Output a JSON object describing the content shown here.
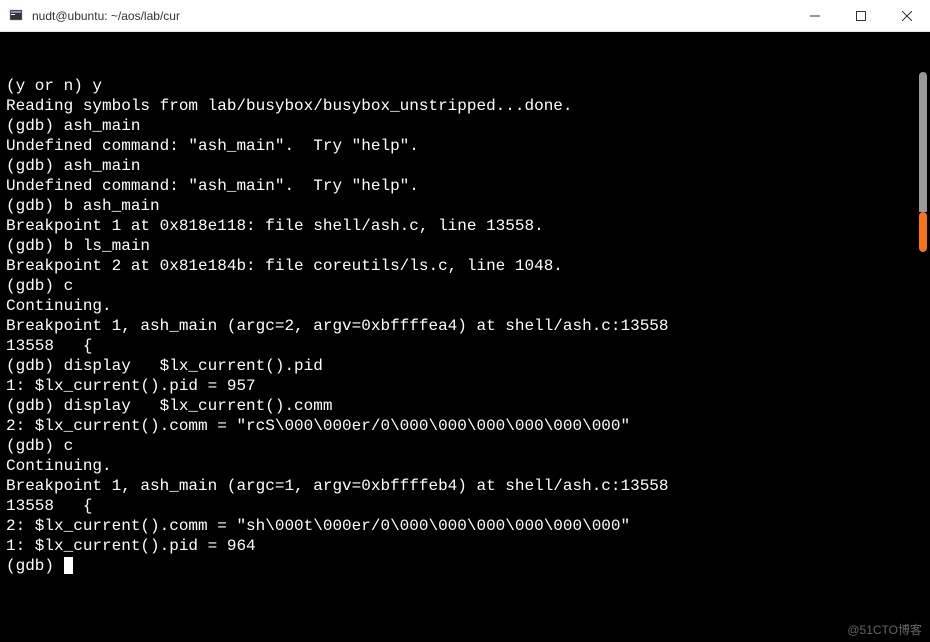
{
  "window": {
    "title": "nudt@ubuntu: ~/aos/lab/cur"
  },
  "terminal": {
    "lines": [
      "(y or n) y",
      "Reading symbols from lab/busybox/busybox_unstripped...done.",
      "(gdb) ash_main",
      "Undefined command: \"ash_main\".  Try \"help\".",
      "(gdb) ash_main",
      "Undefined command: \"ash_main\".  Try \"help\".",
      "(gdb) b ash_main",
      "Breakpoint 1 at 0x818e118: file shell/ash.c, line 13558.",
      "(gdb) b ls_main",
      "Breakpoint 2 at 0x81e184b: file coreutils/ls.c, line 1048.",
      "(gdb) c",
      "Continuing.",
      "",
      "Breakpoint 1, ash_main (argc=2, argv=0xbffffea4) at shell/ash.c:13558",
      "13558   {",
      "(gdb) display   $lx_current().pid",
      "1: $lx_current().pid = 957",
      "(gdb) display   $lx_current().comm",
      "2: $lx_current().comm = \"rcS\\000\\000er/0\\000\\000\\000\\000\\000\\000\"",
      "(gdb) c",
      "Continuing.",
      "",
      "Breakpoint 1, ash_main (argc=1, argv=0xbffffeb4) at shell/ash.c:13558",
      "13558   {",
      "2: $lx_current().comm = \"sh\\000t\\000er/0\\000\\000\\000\\000\\000\\000\"",
      "1: $lx_current().pid = 964",
      "(gdb) "
    ]
  },
  "watermark": "@51CTO博客"
}
